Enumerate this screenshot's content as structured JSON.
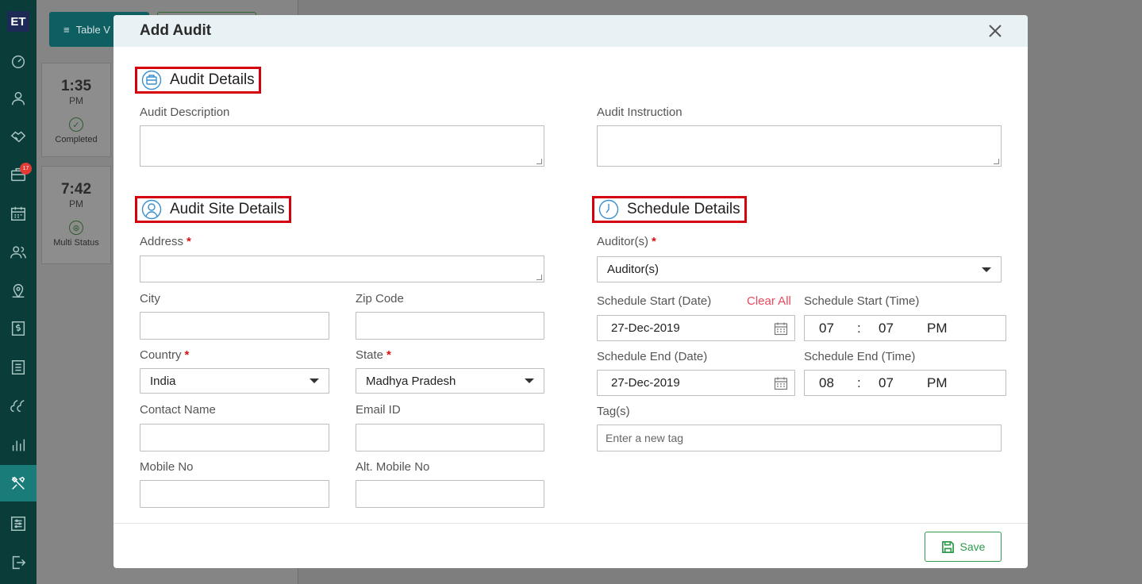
{
  "app": {
    "logo_text": "ET",
    "notification_count": "17"
  },
  "background": {
    "table_button_label": "Table V",
    "cards": [
      {
        "time": "1:35",
        "ampm": "PM",
        "status": "Completed"
      },
      {
        "time": "7:42",
        "ampm": "PM",
        "status": "Multi Status"
      }
    ]
  },
  "modal": {
    "title": "Add Audit",
    "audit_details": {
      "heading": "Audit Details",
      "description_label": "Audit Description",
      "description_value": "",
      "instruction_label": "Audit Instruction",
      "instruction_value": ""
    },
    "site_details": {
      "heading": "Audit Site Details",
      "address_label": "Address",
      "address_value": "",
      "city_label": "City",
      "city_value": "",
      "zip_label": "Zip Code",
      "zip_value": "",
      "country_label": "Country",
      "country_value": "India",
      "state_label": "State",
      "state_value": "Madhya Pradesh",
      "contact_label": "Contact Name",
      "contact_value": "",
      "email_label": "Email ID",
      "email_value": "",
      "mobile_label": "Mobile No",
      "mobile_value": "",
      "alt_mobile_label": "Alt. Mobile No",
      "alt_mobile_value": ""
    },
    "schedule": {
      "heading": "Schedule Details",
      "auditors_label": "Auditor(s)",
      "auditors_value": "Auditor(s)",
      "start_date_label": "Schedule Start (Date)",
      "clear_all": "Clear All",
      "start_time_label": "Schedule Start (Time)",
      "start_date_value": "27-Dec-2019",
      "start_time": {
        "hour": "07",
        "sep": ":",
        "minute": "07",
        "period": "PM"
      },
      "end_date_label": "Schedule End (Date)",
      "end_time_label": "Schedule End (Time)",
      "end_date_value": "27-Dec-2019",
      "end_time": {
        "hour": "08",
        "sep": ":",
        "minute": "07",
        "period": "PM"
      },
      "tags_label": "Tag(s)",
      "tags_placeholder": "Enter a new tag"
    },
    "save_label": "Save"
  }
}
